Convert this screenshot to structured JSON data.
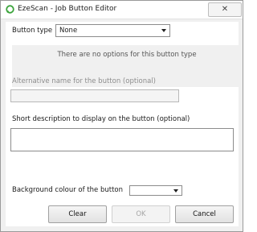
{
  "window": {
    "title": "EzeScan - Job Button Editor",
    "close_label": "✕"
  },
  "button_type": {
    "label": "Button type",
    "selected": "None"
  },
  "options_message": "There are no options for this button type",
  "alt_name": {
    "label": "Alternative name for the button (optional)",
    "value": "",
    "disabled": true
  },
  "short_description": {
    "label": "Short description to display on the button (optional)",
    "value": ""
  },
  "background_colour": {
    "label": "Background colour of the button",
    "selected": ""
  },
  "buttons": {
    "clear": "Clear",
    "ok": "OK",
    "cancel": "Cancel"
  },
  "colors": {
    "app_icon": "#3aa33a",
    "disabled_text": "#8d8d8d"
  }
}
